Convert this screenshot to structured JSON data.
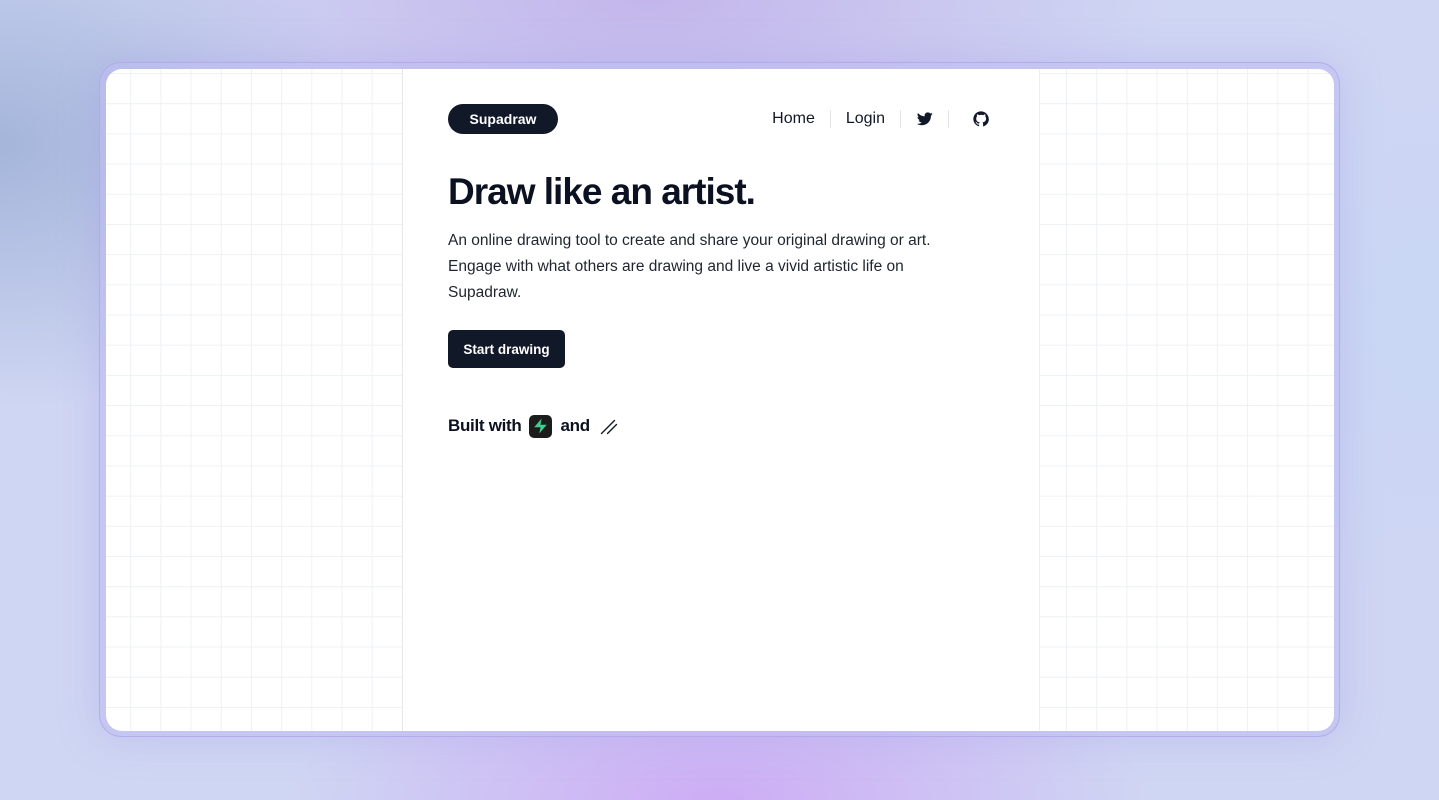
{
  "nav": {
    "brand": "Supadraw",
    "links": [
      {
        "label": "Home"
      },
      {
        "label": "Login"
      }
    ],
    "icons": [
      "twitter-icon",
      "github-icon"
    ]
  },
  "hero": {
    "headline": "Draw like an artist.",
    "description": "An online drawing tool to create and share your original drawing or art. Engage with what others are drawing and live a vivid artistic life on Supadraw.",
    "cta_label": "Start drawing"
  },
  "footer": {
    "built_with": "Built with",
    "and": "and",
    "icons": [
      "supabase-logo-icon",
      "excalidraw-logo-icon"
    ]
  },
  "colors": {
    "primary_dark": "#111827",
    "supabase_green": "#3ecf8e",
    "grid_line": "#eef1f4"
  }
}
